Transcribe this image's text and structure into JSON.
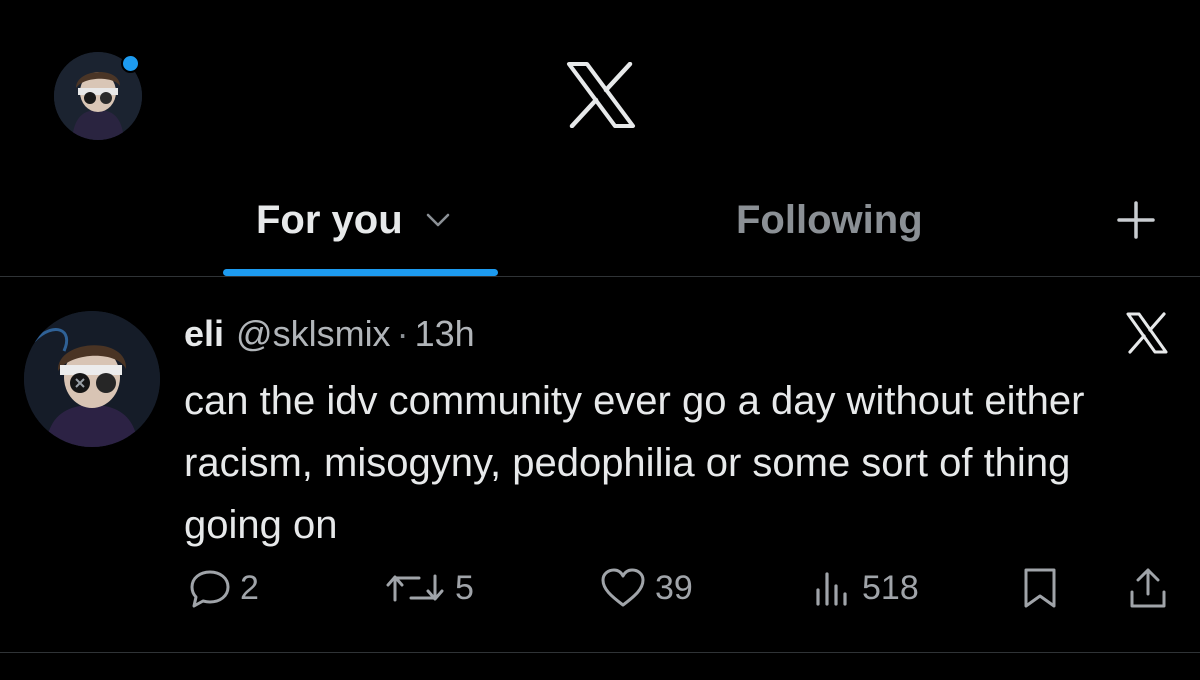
{
  "header": {
    "tabs": [
      {
        "label": "For you",
        "active": true
      },
      {
        "label": "Following",
        "active": false
      }
    ]
  },
  "colors": {
    "background": "#000000",
    "text": "#e7e9ea",
    "muted": "#8b9095",
    "accent": "#1d9bf0"
  },
  "icons": {
    "logo": "x-logo-icon",
    "dropdown": "chevron-down-icon",
    "add": "plus-icon",
    "post_brand": "x-icon",
    "reply": "reply-icon",
    "repost": "repost-icon",
    "like": "heart-icon",
    "views": "views-icon",
    "bookmark": "bookmark-icon",
    "share": "share-icon"
  },
  "tweet": {
    "name": "eli",
    "handle": "@sklsmix",
    "separator": "·",
    "time": "13h",
    "text": "can the idv community ever go a day without either racism, misogyny, pedophilia or some sort of thing going on",
    "stats": {
      "replies": "2",
      "reposts": "5",
      "likes": "39",
      "views": "518"
    }
  }
}
